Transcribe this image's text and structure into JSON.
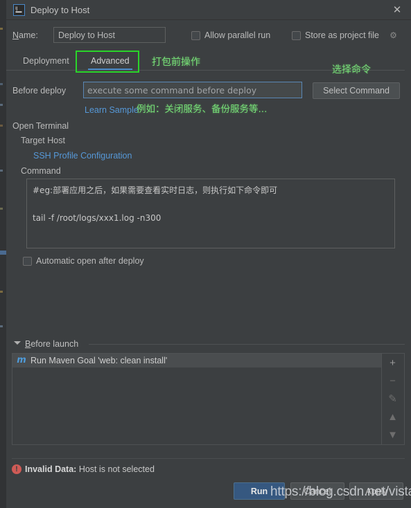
{
  "window": {
    "title": "Deploy to Host",
    "app_icon": "intellij-idea-icon",
    "close_icon": "✕"
  },
  "name_row": {
    "label": "Name:",
    "value": "Deploy to Host",
    "allow_parallel_run": "Allow parallel run",
    "store_as_project_file": "Store as project file",
    "gear_icon": "⚙"
  },
  "tabs": [
    {
      "label": "Deployment",
      "selected": false
    },
    {
      "label": "Advanced",
      "selected": true
    }
  ],
  "annotations": {
    "pre_package": "打包前操作",
    "select_command": "选择命令",
    "example": "例如：关闭服务、备份服务等...",
    "highlight_color": "#2ad52a",
    "text_color": "#77e077"
  },
  "before_deploy": {
    "label": "Before deploy",
    "value": "execute some command before deploy",
    "placeholder": "execute some command before deploy",
    "select_command_button": "Select Command",
    "learn_sample_link": "Learn Sample"
  },
  "tree": {
    "open_terminal": "Open Terminal",
    "target_host": "Target Host",
    "ssh_profile_link": "SSH Profile Configuration",
    "command_label": "Command",
    "command_value": "#eg:部署应用之后，如果需要查看实时日志，则执行如下命令即可\n\ntail -f /root/logs/xxx1.log -n300",
    "automatic_open": "Automatic open after deploy"
  },
  "before_launch": {
    "title": "Before launch",
    "items": [
      {
        "icon": "maven-icon",
        "icon_glyph": "m",
        "label": "Run Maven Goal 'web: clean install'"
      }
    ],
    "toolbar": [
      {
        "name": "add",
        "glyph": "+"
      },
      {
        "name": "remove",
        "glyph": "−"
      },
      {
        "name": "edit",
        "glyph": "✎"
      },
      {
        "name": "move-up",
        "glyph": "▲"
      },
      {
        "name": "move-down",
        "glyph": "▼"
      }
    ]
  },
  "footer": {
    "error_icon": "!",
    "error_prefix": "Invalid Data:",
    "error_message": "Host is not selected",
    "run_button": "Run",
    "cancel_button": "Cancel",
    "apply_button": "Apply"
  },
  "watermark": "https://blog.csdn.net/vistaed",
  "colors": {
    "background": "#3c3f41",
    "accent_blue": "#4a88c7",
    "link_blue": "#5698d7",
    "run_button": "#365880",
    "error_red": "#cf5b56",
    "annotation_green": "#77e077"
  }
}
